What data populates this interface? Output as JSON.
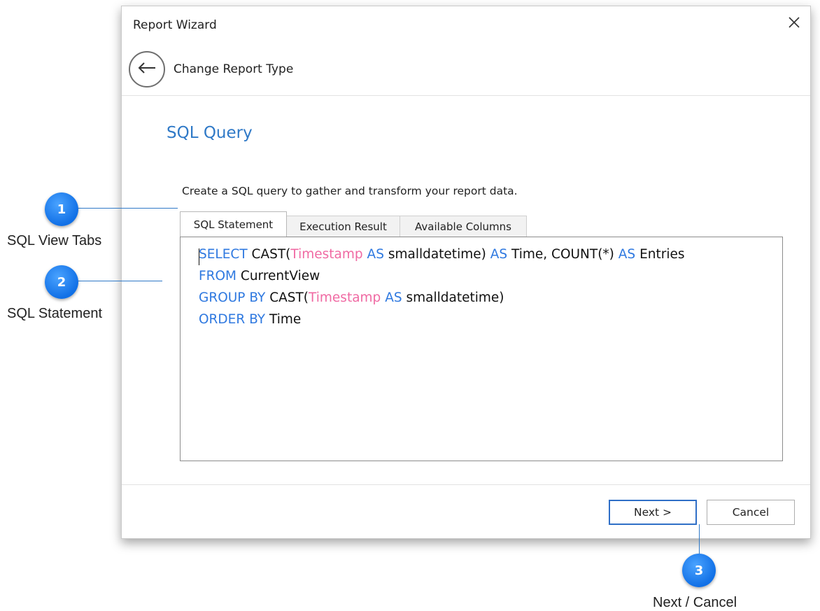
{
  "window": {
    "title": "Report Wizard"
  },
  "nav": {
    "back_label": "Change Report Type"
  },
  "page": {
    "heading": "SQL Query",
    "description": "Create a SQL query to gather and transform your report data."
  },
  "tabs": [
    {
      "label": "SQL Statement",
      "active": true
    },
    {
      "label": "Execution Result",
      "active": false
    },
    {
      "label": "Available Columns",
      "active": false
    }
  ],
  "sql": {
    "line1": {
      "kw1": "SELECT",
      "t1": " CAST(",
      "fn1": "Timestamp",
      "kw2": " AS",
      "t2": " smalldatetime) ",
      "kw3": "AS",
      "t3": " Time, COUNT(*) ",
      "kw4": "AS",
      "t4": " Entries"
    },
    "line2": {
      "kw1": "FROM",
      "t1": " CurrentView"
    },
    "line3": {
      "kw1": "GROUP BY",
      "t1": " CAST(",
      "fn1": "Timestamp",
      "kw2": " AS",
      "t2": " smalldatetime)"
    },
    "line4": {
      "kw1": "ORDER BY",
      "t1": " Time"
    }
  },
  "buttons": {
    "next": "Next >",
    "cancel": "Cancel"
  },
  "callouts": [
    {
      "number": "1",
      "label": "SQL View Tabs"
    },
    {
      "number": "2",
      "label": "SQL Statement"
    },
    {
      "number": "3",
      "label": "Next / Cancel"
    }
  ],
  "colors": {
    "accent": "#2f79c7",
    "keyword": "#2f79e0",
    "function": "#f06aa3",
    "badge": "#1170e6"
  },
  "icons": {
    "close": "close-icon",
    "back": "arrow-left-icon"
  }
}
